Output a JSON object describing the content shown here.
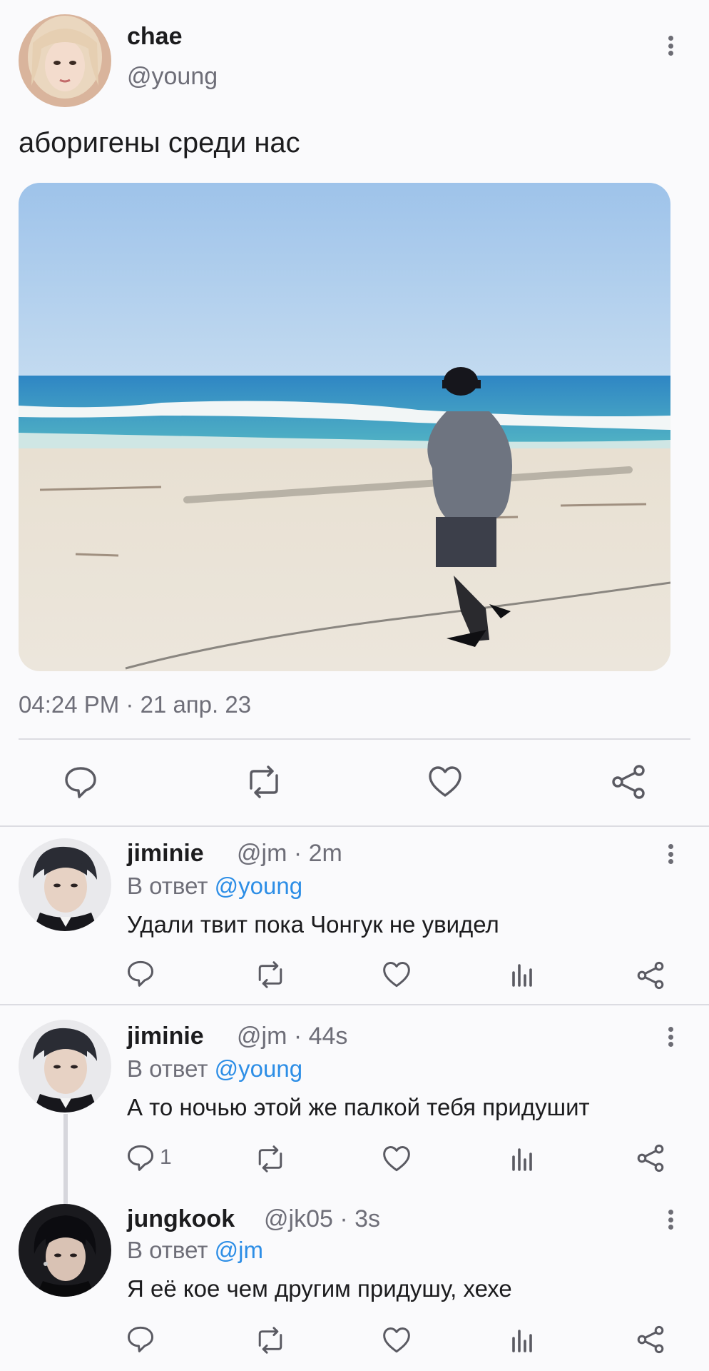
{
  "main_tweet": {
    "author_name": "chae",
    "author_handle": "@young",
    "text": "аборигены среди нас",
    "timestamp": "04:24 PM · 21 апр. 23",
    "actions": [
      "reply-icon",
      "retweet-icon",
      "like-icon",
      "share-icon"
    ]
  },
  "replies": [
    {
      "name": "jiminie",
      "meta": "@jm · 2m",
      "reply_prefix": "В ответ",
      "reply_mention": "@young",
      "text": "Удали твит пока Чонгук не увидел",
      "reply_count": ""
    },
    {
      "name": "jiminie",
      "meta": "@jm · 44s",
      "reply_prefix": "В ответ",
      "reply_mention": "@young",
      "text": "А то ночью этой же палкой тебя придушит",
      "reply_count": "1"
    },
    {
      "name": "jungkook",
      "meta": "@jk05 · 3s",
      "reply_prefix": "В ответ",
      "reply_mention": "@jm",
      "text": "Я её кое чем другим придушу, хехе",
      "reply_count": ""
    }
  ],
  "colors": {
    "mention": "#2d8ee6",
    "muted": "#6e6e78",
    "background": "#fafafc"
  }
}
